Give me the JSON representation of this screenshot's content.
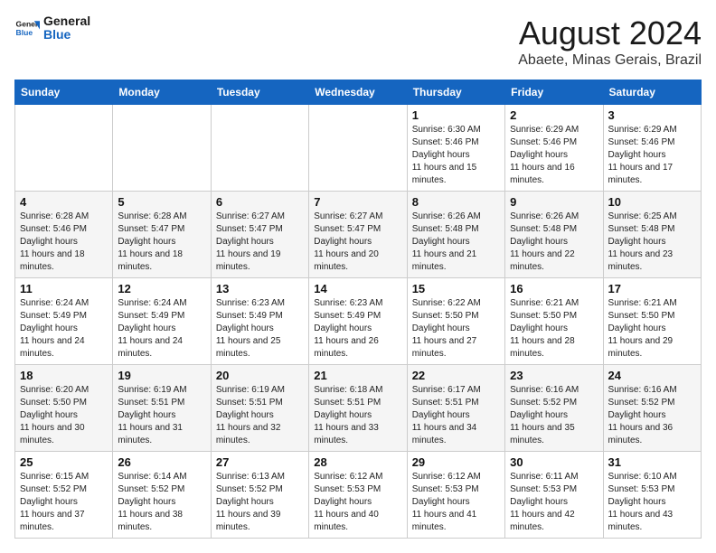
{
  "header": {
    "logo_general": "General",
    "logo_blue": "Blue",
    "month": "August 2024",
    "location": "Abaete, Minas Gerais, Brazil"
  },
  "days_of_week": [
    "Sunday",
    "Monday",
    "Tuesday",
    "Wednesday",
    "Thursday",
    "Friday",
    "Saturday"
  ],
  "weeks": [
    [
      {
        "day": "",
        "sunrise": "",
        "sunset": "",
        "daylight": ""
      },
      {
        "day": "",
        "sunrise": "",
        "sunset": "",
        "daylight": ""
      },
      {
        "day": "",
        "sunrise": "",
        "sunset": "",
        "daylight": ""
      },
      {
        "day": "",
        "sunrise": "",
        "sunset": "",
        "daylight": ""
      },
      {
        "day": "1",
        "sunrise": "6:30 AM",
        "sunset": "5:46 PM",
        "daylight": "11 hours and 15 minutes."
      },
      {
        "day": "2",
        "sunrise": "6:29 AM",
        "sunset": "5:46 PM",
        "daylight": "11 hours and 16 minutes."
      },
      {
        "day": "3",
        "sunrise": "6:29 AM",
        "sunset": "5:46 PM",
        "daylight": "11 hours and 17 minutes."
      }
    ],
    [
      {
        "day": "4",
        "sunrise": "6:28 AM",
        "sunset": "5:46 PM",
        "daylight": "11 hours and 18 minutes."
      },
      {
        "day": "5",
        "sunrise": "6:28 AM",
        "sunset": "5:47 PM",
        "daylight": "11 hours and 18 minutes."
      },
      {
        "day": "6",
        "sunrise": "6:27 AM",
        "sunset": "5:47 PM",
        "daylight": "11 hours and 19 minutes."
      },
      {
        "day": "7",
        "sunrise": "6:27 AM",
        "sunset": "5:47 PM",
        "daylight": "11 hours and 20 minutes."
      },
      {
        "day": "8",
        "sunrise": "6:26 AM",
        "sunset": "5:48 PM",
        "daylight": "11 hours and 21 minutes."
      },
      {
        "day": "9",
        "sunrise": "6:26 AM",
        "sunset": "5:48 PM",
        "daylight": "11 hours and 22 minutes."
      },
      {
        "day": "10",
        "sunrise": "6:25 AM",
        "sunset": "5:48 PM",
        "daylight": "11 hours and 23 minutes."
      }
    ],
    [
      {
        "day": "11",
        "sunrise": "6:24 AM",
        "sunset": "5:49 PM",
        "daylight": "11 hours and 24 minutes."
      },
      {
        "day": "12",
        "sunrise": "6:24 AM",
        "sunset": "5:49 PM",
        "daylight": "11 hours and 24 minutes."
      },
      {
        "day": "13",
        "sunrise": "6:23 AM",
        "sunset": "5:49 PM",
        "daylight": "11 hours and 25 minutes."
      },
      {
        "day": "14",
        "sunrise": "6:23 AM",
        "sunset": "5:49 PM",
        "daylight": "11 hours and 26 minutes."
      },
      {
        "day": "15",
        "sunrise": "6:22 AM",
        "sunset": "5:50 PM",
        "daylight": "11 hours and 27 minutes."
      },
      {
        "day": "16",
        "sunrise": "6:21 AM",
        "sunset": "5:50 PM",
        "daylight": "11 hours and 28 minutes."
      },
      {
        "day": "17",
        "sunrise": "6:21 AM",
        "sunset": "5:50 PM",
        "daylight": "11 hours and 29 minutes."
      }
    ],
    [
      {
        "day": "18",
        "sunrise": "6:20 AM",
        "sunset": "5:50 PM",
        "daylight": "11 hours and 30 minutes."
      },
      {
        "day": "19",
        "sunrise": "6:19 AM",
        "sunset": "5:51 PM",
        "daylight": "11 hours and 31 minutes."
      },
      {
        "day": "20",
        "sunrise": "6:19 AM",
        "sunset": "5:51 PM",
        "daylight": "11 hours and 32 minutes."
      },
      {
        "day": "21",
        "sunrise": "6:18 AM",
        "sunset": "5:51 PM",
        "daylight": "11 hours and 33 minutes."
      },
      {
        "day": "22",
        "sunrise": "6:17 AM",
        "sunset": "5:51 PM",
        "daylight": "11 hours and 34 minutes."
      },
      {
        "day": "23",
        "sunrise": "6:16 AM",
        "sunset": "5:52 PM",
        "daylight": "11 hours and 35 minutes."
      },
      {
        "day": "24",
        "sunrise": "6:16 AM",
        "sunset": "5:52 PM",
        "daylight": "11 hours and 36 minutes."
      }
    ],
    [
      {
        "day": "25",
        "sunrise": "6:15 AM",
        "sunset": "5:52 PM",
        "daylight": "11 hours and 37 minutes."
      },
      {
        "day": "26",
        "sunrise": "6:14 AM",
        "sunset": "5:52 PM",
        "daylight": "11 hours and 38 minutes."
      },
      {
        "day": "27",
        "sunrise": "6:13 AM",
        "sunset": "5:52 PM",
        "daylight": "11 hours and 39 minutes."
      },
      {
        "day": "28",
        "sunrise": "6:12 AM",
        "sunset": "5:53 PM",
        "daylight": "11 hours and 40 minutes."
      },
      {
        "day": "29",
        "sunrise": "6:12 AM",
        "sunset": "5:53 PM",
        "daylight": "11 hours and 41 minutes."
      },
      {
        "day": "30",
        "sunrise": "6:11 AM",
        "sunset": "5:53 PM",
        "daylight": "11 hours and 42 minutes."
      },
      {
        "day": "31",
        "sunrise": "6:10 AM",
        "sunset": "5:53 PM",
        "daylight": "11 hours and 43 minutes."
      }
    ]
  ],
  "labels": {
    "sunrise_prefix": "Sunrise: ",
    "sunset_prefix": "Sunset: ",
    "daylight_label": "Daylight hours"
  }
}
